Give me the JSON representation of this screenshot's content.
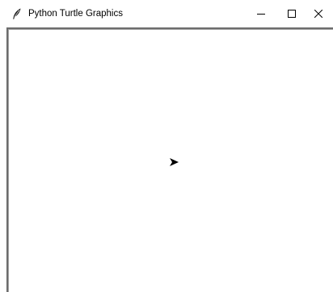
{
  "window": {
    "title": "Python Turtle Graphics",
    "app_icon": "feather-icon",
    "controls": {
      "minimize_icon": "minimize-icon",
      "maximize_icon": "maximize-icon",
      "close_icon": "close-icon"
    }
  },
  "canvas": {
    "background": "#ffffff",
    "turtle_icon": "arrow-cursor-icon",
    "turtle_color": "#000000"
  }
}
